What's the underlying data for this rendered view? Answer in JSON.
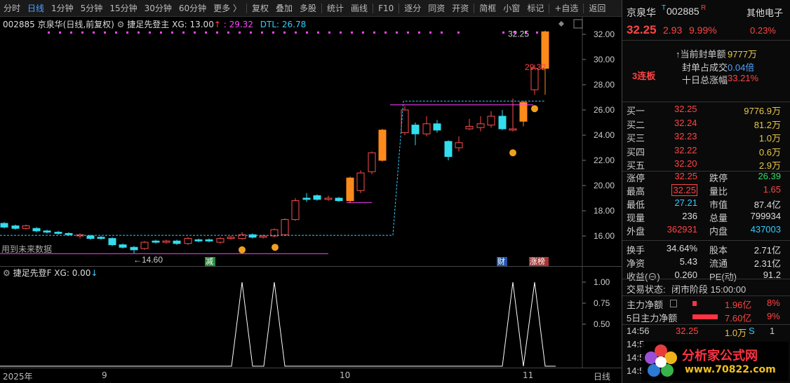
{
  "toolbar": {
    "items": [
      "分时",
      "日线",
      "1分钟",
      "5分钟",
      "15分钟",
      "30分钟",
      "60分钟",
      "更多 〉",
      "复权",
      "叠加",
      "多股",
      "统计",
      "画线",
      "F10",
      "逐分",
      "同资",
      "开资",
      "简框",
      "小窗",
      "标记",
      "+自选",
      "返回"
    ],
    "active": "日线"
  },
  "chart": {
    "header_code": "002885",
    "header_name": "京泉华(日线,前复权)",
    "indicator_name": "捷足先登主",
    "xg_label": "XG: 13.00",
    "arrow": "↑",
    "value1": ": 29.32",
    "dtl": "DTL: 26.78",
    "future_label": "用到未来数据",
    "low_label": "←14.60",
    "high_label": "32.25",
    "mid_label": "29.32",
    "y_ticks": [
      "32.00",
      "30.00",
      "28.00",
      "26.00",
      "24.00",
      "22.00",
      "20.00",
      "18.00",
      "16.00"
    ],
    "marker_jian": "减",
    "marker_cai": "财",
    "marker_zhangbang": "涨榜",
    "lianban": "3连板"
  },
  "sub": {
    "header": "捷足先登F  XG: 0.00",
    "arrow": "↓",
    "y_ticks": [
      "1.00",
      "0.75",
      "0.50"
    ]
  },
  "time_axis": {
    "labels": [
      "2025年",
      "9",
      "10",
      "11"
    ],
    "period": "日线"
  },
  "quote": {
    "name": "京泉华",
    "t_mark": "T",
    "code": "002885",
    "r_mark": "R",
    "sector": "其他电子",
    "sector_pct": "0.23%",
    "price": "32.25",
    "change": "2.93",
    "pct": "9.99%",
    "seal_label": "↑当前封单额",
    "seal_value": "9777万",
    "seal_ratio_label": "封单占成交",
    "seal_ratio_value": "0.04倍",
    "ten_day_label": "十日总涨幅",
    "ten_day_value": "33.21%",
    "bids": [
      {
        "label": "买一",
        "price": "32.25",
        "vol": "9776.9万"
      },
      {
        "label": "买二",
        "price": "32.24",
        "vol": "81.2万"
      },
      {
        "label": "买三",
        "price": "32.23",
        "vol": "1.0万"
      },
      {
        "label": "买四",
        "price": "32.22",
        "vol": "0.6万"
      },
      {
        "label": "买五",
        "price": "32.20",
        "vol": "2.9万"
      }
    ],
    "stats": [
      {
        "l1": "涨停",
        "v1": "32.25",
        "c1": "red",
        "l2": "跌停",
        "v2": "26.39",
        "c2": "green"
      },
      {
        "l1": "最高",
        "v1": "32.25",
        "c1": "red",
        "l2": "量比",
        "v2": "1.65",
        "c2": "red"
      },
      {
        "l1": "最低",
        "v1": "27.21",
        "c1": "cyan",
        "l2": "市值",
        "v2": "87.4亿",
        "c2": "white"
      },
      {
        "l1": "现量",
        "v1": "236",
        "c1": "white",
        "l2": "总量",
        "v2": "799934",
        "c2": "white"
      },
      {
        "l1": "外盘",
        "v1": "362931",
        "c1": "red",
        "l2": "内盘",
        "v2": "437003",
        "c2": "cyan"
      },
      {
        "l1": "换手",
        "v1": "34.64%",
        "c1": "white",
        "l2": "股本",
        "v2": "2.71亿",
        "c2": "white"
      },
      {
        "l1": "净资",
        "v1": "5.43",
        "c1": "white",
        "l2": "流通",
        "v2": "2.31亿",
        "c2": "white"
      },
      {
        "l1": "收益(⊖)",
        "v1": "0.260",
        "c1": "white",
        "l2": "PE(动)",
        "v2": "91.2",
        "c2": "white"
      }
    ],
    "status_label": "交易状态:",
    "status_value": "闭市阶段 15:00:00",
    "main_flow_label": "主力净额",
    "main_flow_value": "1.96亿",
    "main_flow_pct": "8%",
    "five_day_label": "5日主力净额",
    "five_day_value": "7.60亿",
    "five_day_pct": "9%",
    "tick_time": "14:56",
    "tick_price": "32.25",
    "tick_vol": "1.0万",
    "tick_side": "S",
    "tick_num": "1"
  },
  "watermark": {
    "title": "分析家公式网",
    "url": "www.70822.com"
  }
}
